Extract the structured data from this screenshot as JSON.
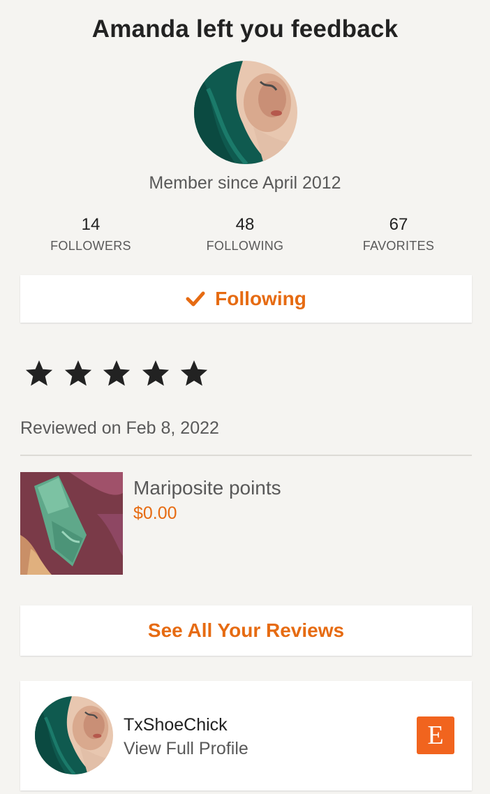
{
  "header": {
    "title": "Amanda left you feedback"
  },
  "profile": {
    "member_since": "Member since April 2012",
    "avatar_icon": "profile-photo"
  },
  "stats": [
    {
      "value": "14",
      "label": "FOLLOWERS"
    },
    {
      "value": "48",
      "label": "FOLLOWING"
    },
    {
      "value": "67",
      "label": "FAVORITES"
    }
  ],
  "follow_button": {
    "label": "Following",
    "icon": "checkmark-icon"
  },
  "review": {
    "rating": 5,
    "max_rating": 5,
    "reviewed_on": "Reviewed on Feb 8, 2022"
  },
  "item": {
    "title": "Mariposite points",
    "price": "$0.00"
  },
  "see_all_button": {
    "label": "See All Your Reviews"
  },
  "shop_card": {
    "shop_name": "TxShoeChick",
    "link_label": "View Full Profile",
    "logo_letter": "E"
  },
  "colors": {
    "accent": "#e66b12",
    "etsy_orange": "#f1641e",
    "background": "#f5f4f1",
    "star": "#222222"
  }
}
